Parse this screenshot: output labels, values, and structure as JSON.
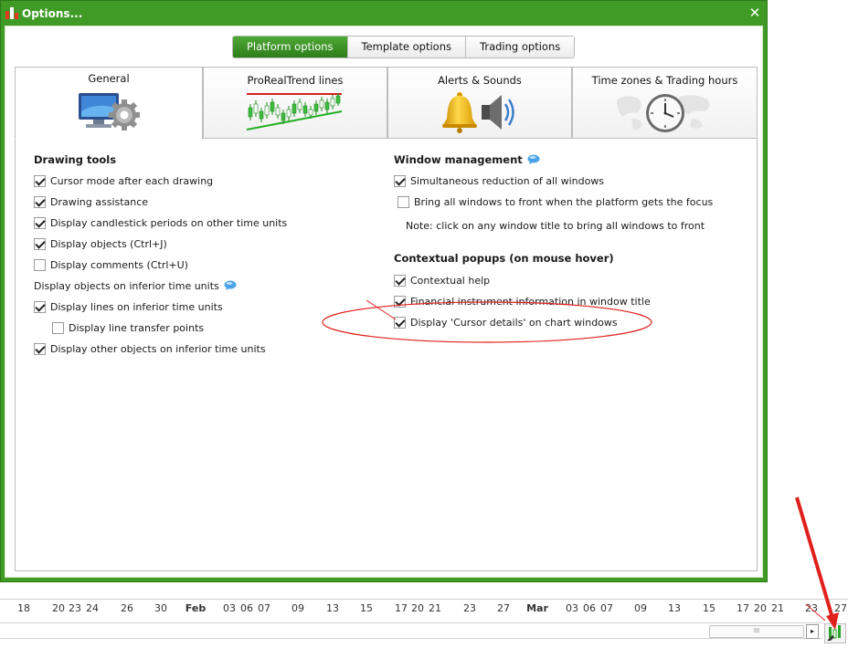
{
  "window": {
    "title": "Options...",
    "close_label": "✕"
  },
  "top_tabs": [
    {
      "label": "Platform options",
      "active": true
    },
    {
      "label": "Template options",
      "active": false
    },
    {
      "label": "Trading options",
      "active": false
    }
  ],
  "category_tabs": [
    {
      "label": "General",
      "icon": "computer-gear-icon",
      "active": true
    },
    {
      "label": "ProRealTrend lines",
      "icon": "trend-lines-chart-icon",
      "active": false
    },
    {
      "label": "Alerts & Sounds",
      "icon": "bell-speaker-icon",
      "active": false
    },
    {
      "label": "Time zones & Trading hours",
      "icon": "clock-world-map-icon",
      "active": false
    }
  ],
  "drawing_tools": {
    "title": "Drawing tools",
    "items": [
      {
        "label": "Cursor mode after each drawing",
        "checked": true
      },
      {
        "label": "Drawing assistance",
        "checked": true
      },
      {
        "label": "Display candlestick periods on other time units",
        "checked": true
      },
      {
        "label": "Display objects (Ctrl+J)",
        "checked": true
      },
      {
        "label": "Display comments (Ctrl+U)",
        "checked": false
      }
    ],
    "inferior_title": "Display objects on inferior time units",
    "inferior_items": [
      {
        "label": "Display lines on inferior time units",
        "checked": true
      },
      {
        "label": "Display line transfer points",
        "checked": false
      },
      {
        "label": "Display other objects on inferior time units",
        "checked": true
      }
    ]
  },
  "window_management": {
    "title": "Window management",
    "items": [
      {
        "label": "Simultaneous reduction of all windows",
        "checked": true
      },
      {
        "label": "Bring all windows to front when the platform gets the focus",
        "checked": false
      }
    ],
    "note": "Note: click on any window title to bring all windows to front"
  },
  "contextual_popups": {
    "title": "Contextual popups (on mouse hover)",
    "items": [
      {
        "label": "Contextual help",
        "checked": true
      },
      {
        "label": "Financial instrument information in window title",
        "checked": true
      },
      {
        "label": "Display 'Cursor details' on chart windows",
        "checked": true
      }
    ]
  },
  "colors": {
    "window_green": "#3f9b26",
    "active_button": "#2e7e1a",
    "annotation_red": "#e0201c"
  },
  "axis_ticks": [
    "18",
    "20",
    "23",
    "24",
    "26",
    "30",
    "Feb",
    "03",
    "06",
    "07",
    "09",
    "13",
    "15",
    "17",
    "20",
    "21",
    "23",
    "27",
    "Mar",
    "03",
    "06",
    "07",
    "09",
    "13",
    "15",
    "17",
    "20",
    "21",
    "23",
    "27"
  ],
  "scrollbar": {
    "thumb_grip": "≡",
    "arrow": "▸"
  }
}
